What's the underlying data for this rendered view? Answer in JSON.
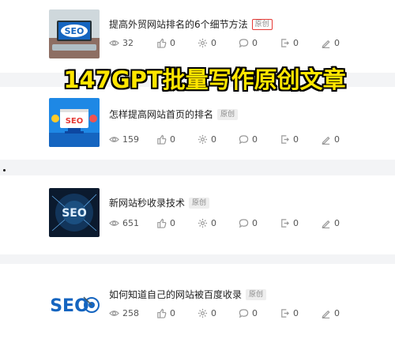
{
  "overlay_title": "147GPT批量写作原创文章",
  "articles": [
    {
      "title": "提高外贸网站排名的6个细节方法",
      "badge": "原创",
      "thumb_text": "SEO",
      "views": "32",
      "likes": "0",
      "shares": "0",
      "comments": "0",
      "forwards": "0",
      "edits": "0"
    },
    {
      "title": "怎样提高网站首页的排名",
      "badge": "原创",
      "thumb_text": "SEO",
      "views": "159",
      "likes": "0",
      "shares": "0",
      "comments": "0",
      "forwards": "0",
      "edits": "0"
    },
    {
      "title": "新网站秒收录技术",
      "badge": "原创",
      "thumb_text": "SEO",
      "views": "651",
      "likes": "0",
      "shares": "0",
      "comments": "0",
      "forwards": "0",
      "edits": "0"
    },
    {
      "title": "如何知道自己的网站被百度收录",
      "badge": "原创",
      "thumb_text": "SEO",
      "views": "258",
      "likes": "0",
      "shares": "0",
      "comments": "0",
      "forwards": "0",
      "edits": "0"
    }
  ],
  "colors": {
    "overlay_text": "#ffe600",
    "badge_outline": "#e53935",
    "card_bg": "#ffffff",
    "page_bg": "#f3f4f6"
  },
  "icons": [
    "eye-icon",
    "thumbs-up-icon",
    "gear-icon",
    "comment-icon",
    "forward-icon",
    "pencil-icon"
  ]
}
